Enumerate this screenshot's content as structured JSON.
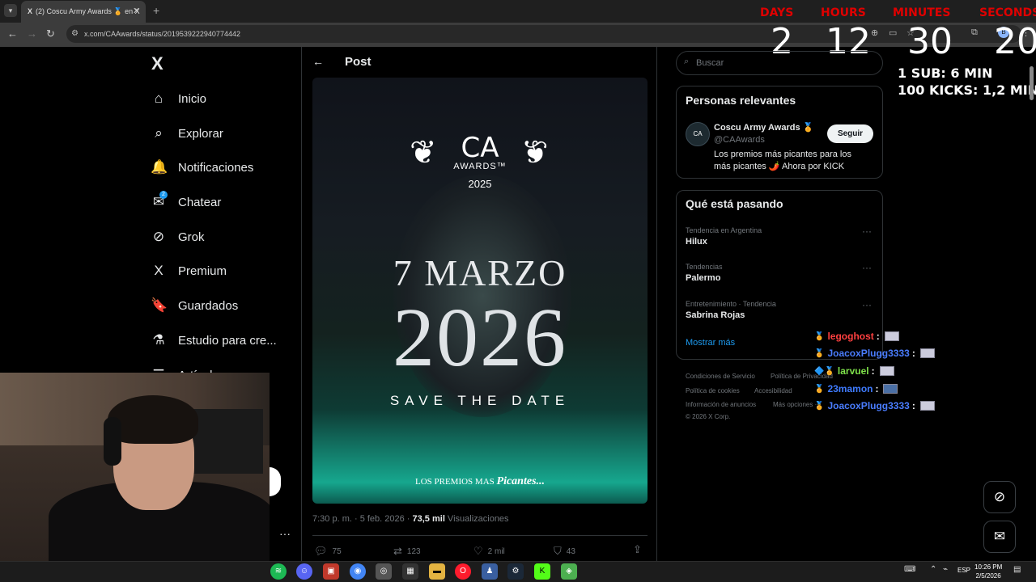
{
  "browser": {
    "tab_title": "(2) Coscu Army Awards 🏅 en X",
    "tab_icon": "X",
    "tab_close": "✕",
    "new_tab": "+",
    "url": "x.com/CAAwards/status/2019539222940774442"
  },
  "countdown": {
    "labels": [
      "DAYS",
      "HOURS",
      "MINUTES",
      "SECONDS"
    ],
    "values": [
      "2",
      "12",
      "30",
      "20"
    ],
    "rates": [
      "1 SUB: 6 MIN",
      "100 KICKS: 1,2 MIN"
    ],
    "label_color": "#e00000"
  },
  "nav": {
    "logo": "X",
    "items": [
      {
        "label": "Inicio",
        "icon": "⌂"
      },
      {
        "label": "Explorar",
        "icon": "⌕"
      },
      {
        "label": "Notificaciones",
        "icon": "🔔"
      },
      {
        "label": "Chatear",
        "icon": "✉"
      },
      {
        "label": "Grok",
        "icon": "⊘"
      },
      {
        "label": "Premium",
        "icon": "X"
      },
      {
        "label": "Guardados",
        "icon": "🔖"
      },
      {
        "label": "Estudio para cre...",
        "icon": "⚗"
      },
      {
        "label": "Artículos",
        "icon": "☰"
      }
    ],
    "chat_badge": "2"
  },
  "post": {
    "back_icon": "←",
    "title": "Post",
    "image": {
      "logo_text": "CA",
      "logo_sub": "AWARDS™",
      "logo_year": "2025",
      "date_line": "7 MARZO",
      "year_line": "2026",
      "save_the_date": "SAVE THE DATE",
      "tagline_prefix": "LOS PREMIOS MAS",
      "tagline_bold": "Picantes..."
    },
    "meta_time": "7:30 p. m. · 5 feb. 2026 · ",
    "meta_views": "73,5 mil",
    "meta_views_label": " Visualizaciones",
    "actions": {
      "replies": "75",
      "reposts": "123",
      "likes": "2 mil",
      "bookmarks": "43"
    }
  },
  "sidebar": {
    "search_placeholder": "Buscar",
    "relevant_title": "Personas relevantes",
    "account": {
      "avatar": "CA",
      "name": "Coscu Army Awards 🏅",
      "handle": "@CAAwards",
      "bio": "Los premios más picantes para los más picantes 🌶️ Ahora por KICK",
      "follow_label": "Seguir"
    },
    "trends_title": "Qué está pasando",
    "trends": [
      {
        "category": "Tendencia en Argentina",
        "name": "Hilux"
      },
      {
        "category": "Tendencias",
        "name": "Palermo"
      },
      {
        "category": "Entretenimiento · Tendencia",
        "name": "Sabrina Rojas"
      }
    ],
    "show_more": "Mostrar más",
    "footer": [
      "Condiciones de Servicio",
      "Política de Privacidad",
      "Política de cookies",
      "Accesibilidad",
      "Información de anuncios",
      "Más opciones ···",
      "© 2026 X Corp."
    ]
  },
  "chat": [
    {
      "user": "legoghost",
      "color": "#ff4040"
    },
    {
      "user": "JoacoxPlugg3333",
      "color": "#4a7dff"
    },
    {
      "user": "larvuel",
      "color": "#7ee04a"
    },
    {
      "user": "23mamon",
      "color": "#3f7bff"
    },
    {
      "user": "JoacoxPlugg3333",
      "color": "#4a7dff"
    }
  ],
  "taskbar": {
    "language": "ESP",
    "time": "10:26 PM",
    "date": "2/5/2026"
  }
}
